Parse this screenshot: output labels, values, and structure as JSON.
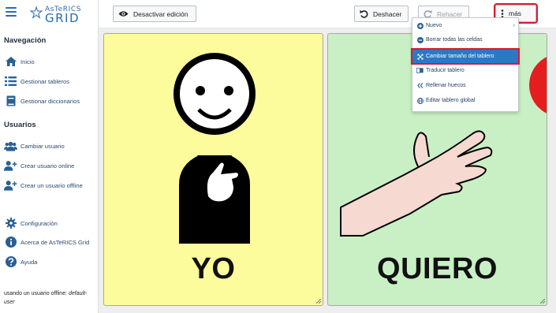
{
  "app": {
    "logo_small": "AsTeRICS",
    "logo_big": "GRID"
  },
  "sidebar": {
    "nav_title": "Navegación",
    "nav_items": [
      {
        "label": "Inicio",
        "icon": "home-icon"
      },
      {
        "label": "Gestionar tableros",
        "icon": "list-icon"
      },
      {
        "label": "Gestionar diccionarios",
        "icon": "book-icon"
      }
    ],
    "users_title": "Usuarios",
    "user_items": [
      {
        "label": "Cambiar usuario",
        "icon": "users-icon"
      },
      {
        "label": "Crear usuario online",
        "icon": "user-plus-icon"
      },
      {
        "label": "Crear un usuario offline",
        "icon": "user-plus-icon"
      }
    ],
    "bottom_items": [
      {
        "label": "Configuración",
        "icon": "gear-icon"
      },
      {
        "label": "Acerca de AsTeRICS Grid",
        "icon": "info-icon"
      },
      {
        "label": "Ayuda",
        "icon": "help-icon"
      }
    ],
    "footer_prefix": "usando un usuario offline: ",
    "footer_user": "default-user"
  },
  "toolbar": {
    "edit_toggle_label": "Desactivar edición",
    "undo_label": "Deshacer",
    "redo_label": "Rehacer",
    "more_label": "más"
  },
  "grid": {
    "cells": [
      {
        "label": "YO",
        "color": "#fcfc9c"
      },
      {
        "label": "QUIERO",
        "color": "#c9f0c5"
      }
    ]
  },
  "menu": {
    "items": [
      {
        "label": "Nuevo",
        "icon": "plus-circle-icon",
        "has_submenu": true
      },
      {
        "label": "Borrar todas las celdas",
        "icon": "minus-circle-icon"
      },
      {
        "label": "Cambiar tamaño del tablero",
        "icon": "resize-arrows-icon",
        "active": true
      },
      {
        "label": "Traducir tablero",
        "icon": "translate-icon"
      },
      {
        "label": "Rellenar huecos",
        "icon": "double-chevron-left-icon"
      },
      {
        "label": "Editar tablero global",
        "icon": "globe-icon"
      }
    ]
  },
  "colors": {
    "accent": "#2a79c4",
    "highlight_outline": "#d61c2f",
    "cell_yellow": "#fcfc9c",
    "cell_green": "#c9f0c5"
  }
}
